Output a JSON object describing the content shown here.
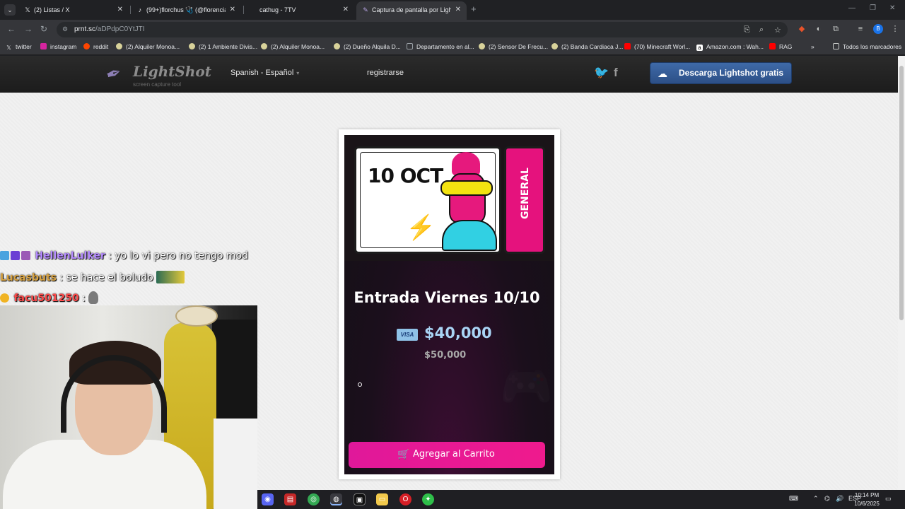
{
  "browser": {
    "tabs": [
      {
        "label": "(2) Listas / X",
        "icon": "x-logo-icon",
        "active": false
      },
      {
        "label": "(99+)florchus 🩺 (@florenciafig",
        "icon": "tiktok-icon",
        "active": false
      },
      {
        "label": "cathug - 7TV",
        "icon": "7tv-icon",
        "active": false
      },
      {
        "label": "Captura de pantalla por Lightsh",
        "icon": "lightshot-feather-icon",
        "active": true
      }
    ],
    "url_host": "prnt.sc",
    "url_path": "/aDPdpC0YtJTI",
    "bookmarks": [
      {
        "label": "twitter",
        "icon": "x-logo-icon"
      },
      {
        "label": "instagram",
        "icon": "instagram-icon"
      },
      {
        "label": "reddit",
        "icon": "reddit-icon"
      },
      {
        "label": "(2) Alquiler Monoa...",
        "icon": "marketplace-icon"
      },
      {
        "label": "(2) 1 Ambiente Divis...",
        "icon": "marketplace-icon"
      },
      {
        "label": "(2) Alquiler Monoa...",
        "icon": "marketplace-icon"
      },
      {
        "label": "(2) Dueño Alquila D...",
        "icon": "marketplace-icon"
      },
      {
        "label": "Departamento en al...",
        "icon": "image-icon"
      },
      {
        "label": "(2) Sensor De Frecu...",
        "icon": "marketplace-icon"
      },
      {
        "label": "(2) Banda Cardiaca J...",
        "icon": "marketplace-icon"
      },
      {
        "label": "(70) Minecraft Worl...",
        "icon": "youtube-icon"
      },
      {
        "label": "Amazon.com : Wah...",
        "icon": "amazon-icon"
      },
      {
        "label": "RAG",
        "icon": "youtube-icon"
      }
    ],
    "all_bookmarks": "Todos los marcadores",
    "profile_initial": "B"
  },
  "lightshot": {
    "brand": "LightShot",
    "tagline": "screen capture tool",
    "language": "Spanish - Español",
    "register": "registrarse",
    "download": "Descarga Lightshot gratis"
  },
  "screenshot": {
    "ticket_date": "10 OCT",
    "ticket_stub": "GENERAL",
    "title": "Entrada Viernes 10/10",
    "card_brand": "VISA",
    "price": "$40,000",
    "old_price": "$50,000",
    "cart_button": "Agregar al Carrito"
  },
  "chat": [
    {
      "user": "HellenLulker",
      "message": ": yo lo vi pero no tengo mod",
      "color": "#b58cff"
    },
    {
      "user": "Lucasbuts",
      "message": ": se hace el boludo",
      "color": "#d9a444"
    },
    {
      "user": "facu501250",
      "message": ":",
      "color": "#ff4b4b"
    }
  ],
  "taskbar": {
    "language": "ESP",
    "time": "10:14 PM",
    "date": "10/6/2025"
  },
  "colors": {
    "accent_pink": "#e6197d",
    "price_blue": "#a9d4f5",
    "download_blue": "#3f6aa8"
  }
}
